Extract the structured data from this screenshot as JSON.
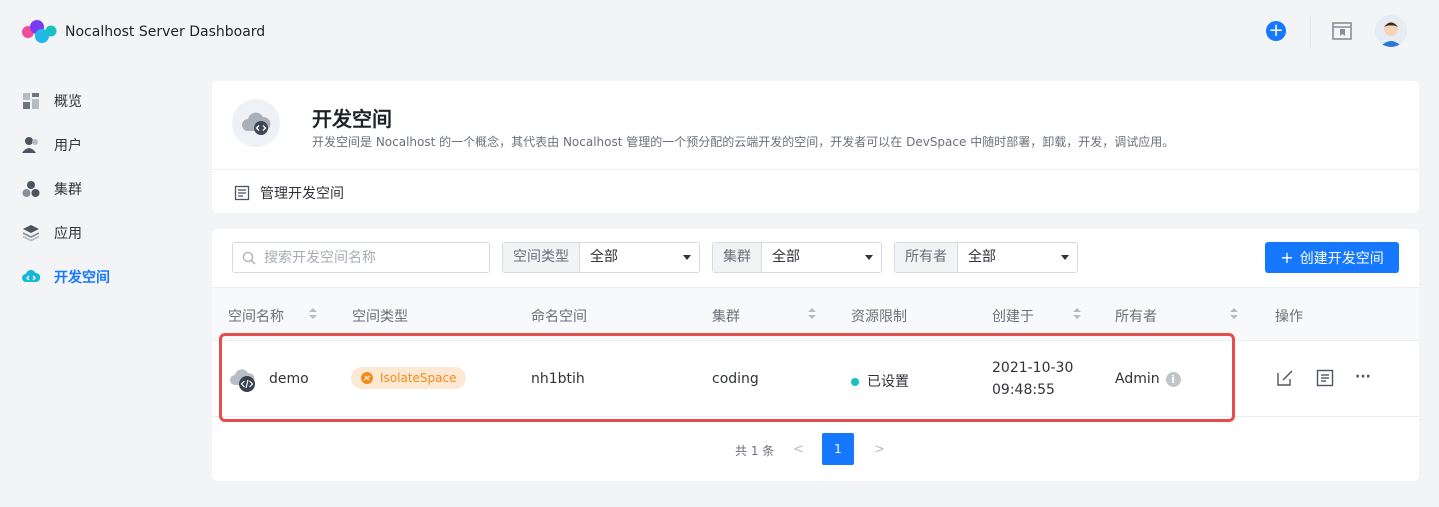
{
  "app": {
    "title": "Nocalhost Server Dashboard"
  },
  "sidebar": {
    "items": [
      {
        "label": "概览",
        "icon": "overview-icon"
      },
      {
        "label": "用户",
        "icon": "user-icon"
      },
      {
        "label": "集群",
        "icon": "cluster-icon"
      },
      {
        "label": "应用",
        "icon": "application-icon"
      },
      {
        "label": "开发空间",
        "icon": "devspace-icon",
        "active": true
      }
    ]
  },
  "page": {
    "title": "开发空间",
    "description": "开发空间是 Nocalhost 的一个概念，其代表由 Nocalhost 管理的一个预分配的云端开发的空间，开发者可以在 DevSpace 中随时部署，卸载，开发，调试应用。",
    "manage_link": "管理开发空间"
  },
  "filters": {
    "search_placeholder": "搜索开发空间名称",
    "space_type": {
      "label": "空间类型",
      "value": "全部"
    },
    "cluster": {
      "label": "集群",
      "value": "全部"
    },
    "owner": {
      "label": "所有者",
      "value": "全部"
    },
    "create_button": "创建开发空间"
  },
  "table": {
    "columns": [
      "空间名称",
      "空间类型",
      "命名空间",
      "集群",
      "资源限制",
      "创建于",
      "所有者",
      "操作"
    ],
    "rows": [
      {
        "name": "demo",
        "type": "IsolateSpace",
        "namespace": "nh1btih",
        "cluster": "coding",
        "resource_limit": "已设置",
        "created_date": "2021-10-30",
        "created_time": "09:48:55",
        "owner": "Admin",
        "more": "···"
      }
    ]
  },
  "pagination": {
    "total": "共 1 条",
    "current": "1",
    "prev": "<",
    "next": ">"
  },
  "colors": {
    "primary": "#1677ff",
    "highlight": "#e84d4d",
    "tag_bg": "#fde8d3",
    "tag_text": "#f08c1a",
    "status_dot": "#15c1c1"
  }
}
